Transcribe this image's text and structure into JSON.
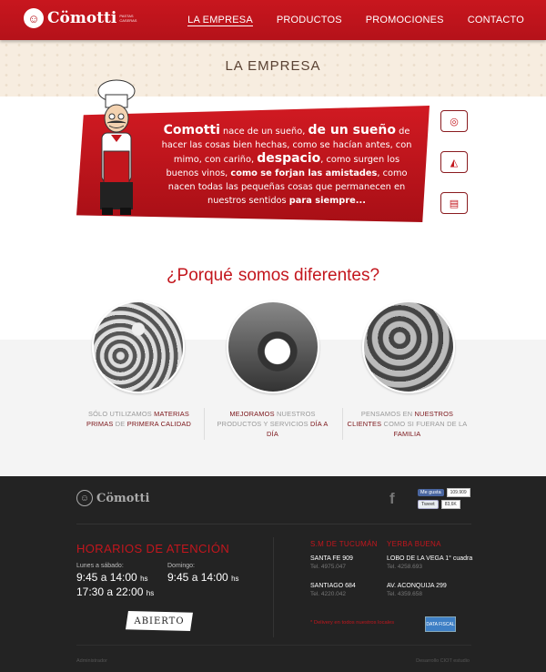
{
  "nav": {
    "logo": "Cömotti",
    "logo_tagline": "PASTAS CASERAS",
    "items": [
      {
        "label": "LA EMPRESA"
      },
      {
        "label": "PRODUCTOS"
      },
      {
        "label": "PROMOCIONES"
      },
      {
        "label": "CONTACTO"
      }
    ]
  },
  "section_title": "LA EMPRESA",
  "intro": {
    "brand": "Comotti",
    "p1": " nace de un sueño, ",
    "p2": "de un sueño",
    "p3": " de hacer las cosas bien hechas, como se hacían antes, con mimo, con cariño, ",
    "p4": "despacio",
    "p5": ", como surgen los buenos vinos, ",
    "p6": "como se forjan las amistades",
    "p7": ", como nacen todas las pequeñas cosas que permanecen en nuestros sentidos ",
    "p8": "para siempre..."
  },
  "diferentes": {
    "q": "¿Porqué",
    "rest": "somos diferentes?",
    "items": [
      {
        "pre": "SÓLO UTILIZAMOS ",
        "em1": "MATERIAS PRIMAS",
        "mid": " DE ",
        "em2": "PRIMERA CALIDAD",
        "post": ""
      },
      {
        "pre": "",
        "em1": "MEJORAMOS",
        "mid": " NUESTROS PRODUCTOS Y SERVICIOS ",
        "em2": "DÍA A DÍA",
        "post": ""
      },
      {
        "pre": "PENSAMOS EN ",
        "em1": "NUESTROS CLIENTES",
        "mid": " COMO SI FUERAN DE LA ",
        "em2": "FAMILIA",
        "post": ""
      }
    ]
  },
  "footer": {
    "logo": "Cömotti",
    "social": {
      "like_label": "Me gusta",
      "like_count": "109.909",
      "tweet_label": "Tweet",
      "tweet_count": "83,6K"
    },
    "horarios_title": "HORARIOS DE ATENCIÓN",
    "weekday_label": "Lunes a sábado:",
    "weekday_1": "9:45 a 14:00",
    "weekday_2": "17:30 a 22:00",
    "sunday_label": "Domingo:",
    "sunday_1": "9:45 a 14:00",
    "hs": "hs",
    "status": "ABIERTO",
    "branches": [
      {
        "title": "S.M DE TUCUMÁN",
        "a1": "SANTA FE 909",
        "t1": "Tel. 4975.047",
        "a2": "SANTIAGO 684",
        "t2": "Tel. 4220.042"
      },
      {
        "title": "YERBA BUENA",
        "a1": "LOBO DE LA VEGA 1° cuadra",
        "t1": "Tel. 4258.693",
        "a2": "AV. ACONQUIJA 299",
        "t2": "Tel. 4359.658"
      }
    ],
    "delivery_star": "*",
    "delivery": " Delivery en todos nuestros locales",
    "data_fiscal": "DATA FISCAL",
    "bottom_left": "Administrador",
    "bottom_right": "Desarrollo CIOT estudio"
  }
}
